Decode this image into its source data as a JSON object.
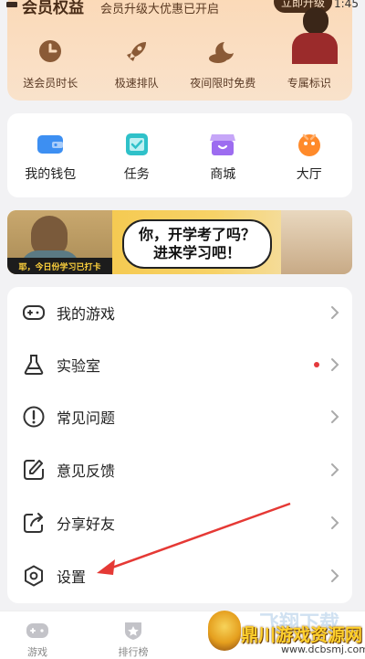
{
  "status_bar": {
    "time": "1:45"
  },
  "vip": {
    "title": "会员权益",
    "subtitle": "会员升级大优惠已开启",
    "action_label": "立即升级",
    "benefits": [
      {
        "label": "送会员时长",
        "icon": "clock-icon"
      },
      {
        "label": "极速排队",
        "icon": "rocket-icon"
      },
      {
        "label": "夜间限时免费",
        "icon": "moon-icon"
      },
      {
        "label": "专属标识",
        "icon": "badge-icon"
      }
    ]
  },
  "quick_entries": [
    {
      "label": "我的钱包",
      "icon": "wallet-icon",
      "color": "#3d8ff2"
    },
    {
      "label": "任务",
      "icon": "task-icon",
      "color": "#2fc1c9"
    },
    {
      "label": "商城",
      "icon": "shop-icon",
      "color": "#9d6cf0"
    },
    {
      "label": "大厅",
      "icon": "lobby-icon",
      "color": "#ff8a2a"
    }
  ],
  "banner": {
    "tag": "耶，今日份学习已打卡",
    "line1": "你，开学考了吗？",
    "line2": "进来学习吧！"
  },
  "menu": [
    {
      "label": "我的游戏",
      "icon": "gamepad-icon",
      "has_dot": false
    },
    {
      "label": "实验室",
      "icon": "flask-icon",
      "has_dot": true
    },
    {
      "label": "常见问题",
      "icon": "help-icon",
      "has_dot": false
    },
    {
      "label": "意见反馈",
      "icon": "feedback-icon",
      "has_dot": false
    },
    {
      "label": "分享好友",
      "icon": "share-icon",
      "has_dot": false
    },
    {
      "label": "设置",
      "icon": "settings-icon",
      "has_dot": false
    }
  ],
  "tabbar": [
    {
      "label": "游戏",
      "icon": "gamepad-tab-icon"
    },
    {
      "label": "排行榜",
      "icon": "ranking-tab-icon"
    }
  ],
  "watermark": {
    "ghost_text": "飞翔下载",
    "title": "鼎川游戏资源网",
    "url": "www.dcbsmj.com"
  },
  "colors": {
    "accent_red": "#e4393c",
    "vip_brown": "#4a2e1a",
    "annotation_red": "#e53935"
  }
}
